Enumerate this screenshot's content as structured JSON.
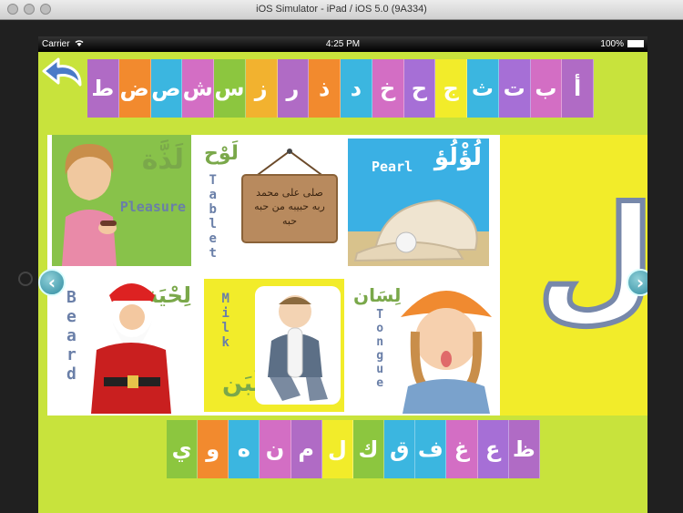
{
  "window": {
    "title": "iOS Simulator - iPad / iOS 5.0 (9A334)"
  },
  "status_bar": {
    "carrier": "Carrier",
    "time": "4:25 PM",
    "battery": "100%"
  },
  "colors": {
    "app_bg": "#c8e33c",
    "panel_yellow": "#f2ec2a",
    "label_blue": "#6a7fa8",
    "arabic_green": "#7aa84a"
  },
  "top_letters": [
    "ط",
    "ض",
    "ص",
    "ش",
    "س",
    "ز",
    "ر",
    "ذ",
    "د",
    "خ",
    "ح",
    "ج",
    "ث",
    "ت",
    "ب",
    "أ"
  ],
  "top_colors": [
    "#b06bc5",
    "#f28a2e",
    "#3bb6e0",
    "#d36ec4",
    "#8cc63f",
    "#f2b22f",
    "#b06bc5",
    "#f28a2e",
    "#3bb6e0",
    "#d36ec4",
    "#a66fd6",
    "#f2ec2a",
    "#3bb6e0",
    "#a66fd6",
    "#d36ec4",
    "#b06bc5"
  ],
  "bottom_letters": [
    "ي",
    "و",
    "ه",
    "ن",
    "م",
    "ل",
    "ك",
    "ق",
    "ف",
    "غ",
    "ع",
    "ظ"
  ],
  "bottom_colors": [
    "#8cc63f",
    "#f28a2e",
    "#3bb6e0",
    "#d36ec4",
    "#b06bc5",
    "#f2ec2a",
    "#8cc63f",
    "#3bb6e0",
    "#3bb6e0",
    "#d36ec4",
    "#a66fd6",
    "#b06bc5"
  ],
  "featured_letter": "ل",
  "cards": {
    "pleasure": {
      "ar": "لَذَّة",
      "en": "Pleasure"
    },
    "tablet": {
      "ar": "لَوْح",
      "en": "Tablet",
      "sign_text": "صلى على محمد ربه حبيبه من حبه حبه"
    },
    "pearl": {
      "ar": "لُؤْلُؤ",
      "en": "Pearl"
    },
    "beard": {
      "ar": "لِحْيَة",
      "en": "Beard"
    },
    "milk": {
      "ar": "لَبَن",
      "en": "Milk"
    },
    "tongue": {
      "ar": "لِسَان",
      "en": "Tongue"
    }
  }
}
